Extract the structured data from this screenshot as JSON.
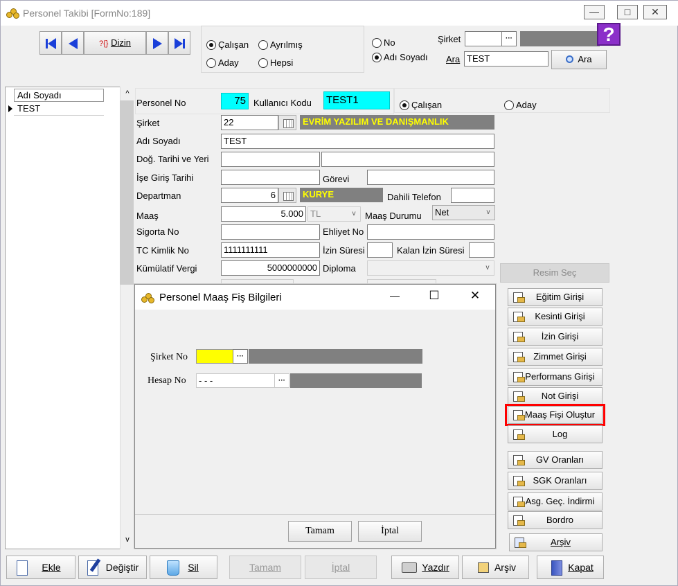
{
  "window": {
    "title": "Personel Takibi [FormNo:189]",
    "minimize": "—",
    "maximize": "□",
    "close": "✕"
  },
  "nav": {
    "dizin_label": "Dizin",
    "dizin_prefix": "?{}"
  },
  "status_group": {
    "calisan": "Çalışan",
    "ayrilmis": "Ayrılmış",
    "aday": "Aday",
    "hepsi": "Hepsi",
    "selected": "Çalışan"
  },
  "search": {
    "no_label": "No",
    "adsoyad_label": "Adı Soyadı",
    "selected": "Adı Soyadı",
    "sirket_label": "Şirket",
    "sirket_value": "",
    "ellipsis": "···",
    "ara_label": "Ara",
    "ara_value": "TEST",
    "ara_button": "Ara",
    "help_icon": "?"
  },
  "grid": {
    "header": "Adı Soyadı",
    "rows": [
      "TEST"
    ],
    "scroll_up": "^",
    "scroll_down": "v"
  },
  "form": {
    "personel_no_label": "Personel No",
    "personel_no": "75",
    "kullanici_kodu_label": "Kullanıcı Kodu",
    "kullanici_kodu": "TEST1",
    "type_calisan": "Çalışan",
    "type_aday": "Aday",
    "sirket_label": "Şirket",
    "sirket_no": "22",
    "sirket_name": "EVRİM YAZILIM VE DANIŞMANLIK",
    "adsoyad_label": "Adı Soyadı",
    "adsoyad": "TEST",
    "dogum_label": "Doğ. Tarihi ve Yeri",
    "dogum_tarihi": "",
    "dogum_yeri": "",
    "ise_giris_label": "İşe Giriş Tarihi",
    "ise_giris": "",
    "gorevi_label": "Görevi",
    "gorevi": "",
    "departman_label": "Departman",
    "departman_no": "6",
    "departman_name": "KURYE",
    "dahili_label": "Dahili Telefon",
    "dahili": "",
    "maas_label": "Maaş",
    "maas": "5.000",
    "currency": "TL",
    "maas_durumu_label": "Maaş Durumu",
    "maas_durumu": "Net",
    "sigorta_label": "Sigorta No",
    "sigorta": "",
    "ehliyet_label": "Ehliyet No",
    "ehliyet": "",
    "tc_label": "TC Kimlik No",
    "tc": "1111111111",
    "izin_label": "İzin Süresi",
    "izin": "",
    "kalan_izin_label": "Kalan İzin Süresi",
    "kalan_izin": "",
    "kumulatif_label": "Kümülatif Vergi",
    "kumulatif": "5000000000",
    "diploma_label": "Diploma",
    "diploma": ""
  },
  "side_buttons": {
    "resim_sec": "Resim Seç",
    "items": [
      "Eğitim Girişi",
      "Kesinti Girişi",
      "İzin Girişi",
      "Zimmet Girişi",
      "Performans Girişi",
      "Not Girişi",
      "Maaş Fişi Oluştur",
      "Log",
      "GV Oranları",
      "SGK Oranları",
      "Asg. Geç. İndirmi",
      "Bordro",
      "Arşiv"
    ],
    "highlight_color": "#ff0000"
  },
  "dialog": {
    "title": "Personel Maaş Fiş Bilgileri",
    "minimize": "—",
    "maximize": "☐",
    "close": "✕",
    "sirket_no_label": "Şirket No",
    "sirket_no": "",
    "hesap_no_label": "Hesap No",
    "hesap_no": "-  -  -",
    "ellipsis": "···",
    "ok": "Tamam",
    "cancel": "İptal"
  },
  "bottom_toolbar": {
    "ekle": "Ekle",
    "degistir": "Değiştir",
    "sil": "Sil",
    "tamam": "Tamam",
    "iptal": "İptal",
    "yazdir": "Yazdır",
    "arsiv": "Arşiv",
    "kapat": "Kapat"
  },
  "colors": {
    "cyan_field": "#00ffff",
    "yellow_field": "#ffff00",
    "gray_band": "#808080",
    "yellow_text": "#ffff00",
    "help_purple": "#8b2fc9"
  }
}
